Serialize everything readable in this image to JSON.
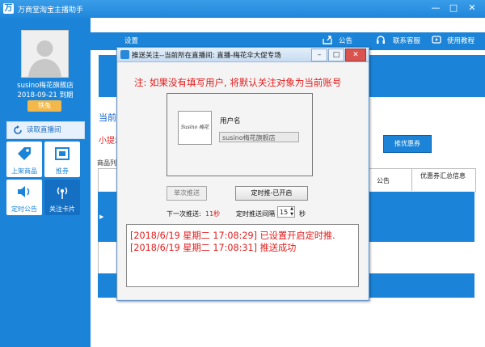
{
  "window": {
    "title": "万商堂淘宝主播助手",
    "controls": [
      "—",
      "□",
      "✕"
    ]
  },
  "sidebar": {
    "shop_name": "susino梅花旗舰店",
    "expiry": "2018-09-21 到期",
    "level_badge": "铁兔",
    "read_live_label": "读取直播间",
    "tiles": [
      {
        "label": "上架商品",
        "icon": "tag-icon"
      },
      {
        "label": "推券",
        "icon": "coupon-icon"
      },
      {
        "label": "定时公告",
        "icon": "speaker-icon"
      },
      {
        "label": "关注卡片",
        "icon": "broadcast-icon"
      }
    ]
  },
  "top_bar": {
    "settings_label": "设置",
    "announce_label": "公告",
    "support_label": "联系客服",
    "tutorial_label": "使用教程"
  },
  "main": {
    "current_link": "当前",
    "tip_prefix": "小提示",
    "coupon_button": "推优惠券",
    "goods_list_label": "商品列",
    "grid_columns": [
      "公告",
      "优惠券汇总信息"
    ]
  },
  "dialog": {
    "title": "推送关注--当前所在直播间: 直播-梅花伞大促专场",
    "notice": "注: 如果没有填写用户, 将默认关注对象为当前账号",
    "shop_logo_text": "Susino 梅花",
    "username_label": "用户名",
    "username_value": "susino梅花旗舰店",
    "single_push_label": "单次推送",
    "timer_push_label": "定时推-已开启",
    "next_push_label": "下一次推送:",
    "next_push_value": "11秒",
    "interval_label": "定时推送间隔",
    "interval_value": "15",
    "interval_unit": "秒",
    "log_lines": [
      "[2018/6/19 星期二 17:08:29] 已设置开启定时推.",
      "[2018/6/19 星期二 17:08:31] 推送成功"
    ]
  },
  "colors": {
    "primary_blue": "#1b84d8",
    "notice_red": "#e31b1b",
    "badge_orange": "#f2b84b"
  }
}
